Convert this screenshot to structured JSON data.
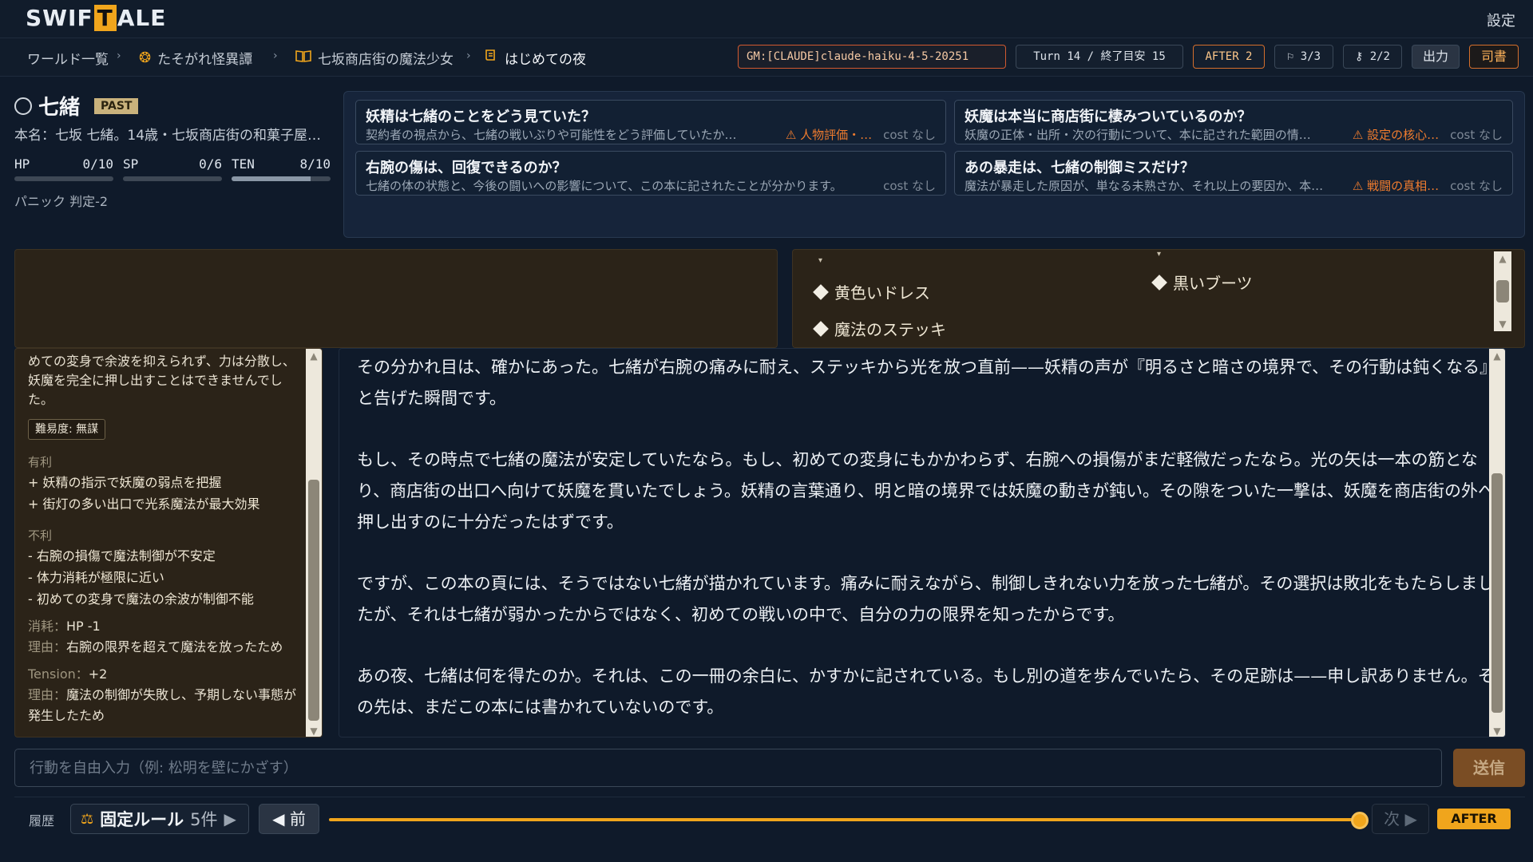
{
  "app": {
    "logo_pre": "SWIF",
    "logo_mid": "T",
    "logo_post": "ALE",
    "settings": "設定"
  },
  "breadcrumb": {
    "items": [
      "ワールド一覧",
      "たそがれ怪異譚",
      "七坂商店街の魔法少女",
      "はじめての夜"
    ],
    "separator": "›"
  },
  "status": {
    "gm": "GM:[CLAUDE]claude-haiku-4-5-20251",
    "turn": "Turn 14 / 終了目安 15",
    "after": "AFTER 2",
    "flags": "3/3",
    "keys": "2/2",
    "export": "出力",
    "librarian": "司書"
  },
  "character": {
    "name": "七緒",
    "badge": "PAST",
    "realname": "本名：七坂 七緒。14歳・七坂商店街の和菓子屋…",
    "stats": [
      {
        "label": "HP",
        "value": "0/10",
        "ratio": 0.0
      },
      {
        "label": "SP",
        "value": "0/6",
        "ratio": 0.0
      },
      {
        "label": "TEN",
        "value": "8/10",
        "ratio": 0.8
      }
    ],
    "panic": "パニック 判定-2"
  },
  "questions": [
    {
      "title": "妖精は七緒のことをどう見ていた？",
      "desc": "契約者の視点から、七緒の戦いぶりや可能性をどう評価していたか…",
      "warn": "⚠ 人物評価・…",
      "cost": "cost なし"
    },
    {
      "title": "右腕の傷は、回復できるのか？",
      "desc": "七緒の体の状態と、今後の闘いへの影響について、この本に記されたことが分かります。",
      "warn": "",
      "cost": "cost なし"
    },
    {
      "title": "妖魔は本当に商店街に棲みついているのか？",
      "desc": "妖魔の正体・出所・次の行動について、本に記された範囲の情…",
      "warn": "⚠ 設定の核心…",
      "cost": "cost なし"
    },
    {
      "title": "あの暴走は、七緒の制御ミスだけ？",
      "desc": "魔法が暴走した原因が、単なる未熟さか、それ以上の要因か、本…",
      "warn": "⚠ 戦闘の真相…",
      "cost": "cost なし"
    }
  ],
  "items": [
    "黄色いドレス",
    "魔法のステッキ",
    "黒いブーツ"
  ],
  "log": {
    "intro": "めての変身で余波を抑えられず、力は分散し、妖魔を完全に押し出すことはできませんでした。",
    "difficulty": "難易度: 無謀",
    "pros_label": "有利",
    "pros": [
      "+ 妖精の指示で妖魔の弱点を把握",
      "+ 街灯の多い出口で光系魔法が最大効果"
    ],
    "cons_label": "不利",
    "cons": [
      "- 右腕の損傷で魔法制御が不安定",
      "- 体力消耗が極限に近い",
      "- 初めての変身で魔法の余波が制御不能"
    ],
    "cost_label": "消耗：",
    "cost_value": "HP -1",
    "reason_label": "理由：",
    "cost_reason": "右腕の限界を超えて魔法を放ったため",
    "tension_label": "Tension：",
    "tension_value": "+2",
    "tension_reason": "魔法の制御が失敗し、予期しない事態が発生したため"
  },
  "story": {
    "paragraphs": [
      "その分かれ目は、確かにあった。七緒が右腕の痛みに耐え、ステッキから光を放つ直前——妖精の声が『明るさと暗さの境界で、その行動は鈍くなる』と告げた瞬間です。",
      "もし、その時点で七緒の魔法が安定していたなら。もし、初めての変身にもかかわらず、右腕への損傷がまだ軽微だったなら。光の矢は一本の筋となり、商店街の出口へ向けて妖魔を貫いたでしょう。妖精の言葉通り、明と暗の境界では妖魔の動きが鈍い。その隙をついた一撃は、妖魔を商店街の外へ押し出すのに十分だったはずです。",
      "ですが、この本の頁には、そうではない七緒が描かれています。痛みに耐えながら、制御しきれない力を放った七緒が。その選択は敗北をもたらしましたが、それは七緒が弱かったからではなく、初めての戦いの中で、自分の力の限界を知ったからです。",
      "あの夜、七緒は何を得たのか。それは、この一冊の余白に、かすかに記されている。もし別の道を歩んでいたら、その足跡は——申し訳ありません。その先は、まだこの本には書かれていないのです。"
    ]
  },
  "input": {
    "placeholder": "行動を自由入力（例: 松明を壁にかざす）",
    "send": "送信"
  },
  "history": {
    "label": "履歴",
    "rule_label": "固定ルール",
    "rule_count": "5件",
    "prev": "◀ 前",
    "next": "次 ▶",
    "after": "AFTER",
    "position": 1.0
  },
  "colors": {
    "accent": "#f0a51c",
    "warning": "#f07c2e",
    "background": "#0f1a2a"
  }
}
